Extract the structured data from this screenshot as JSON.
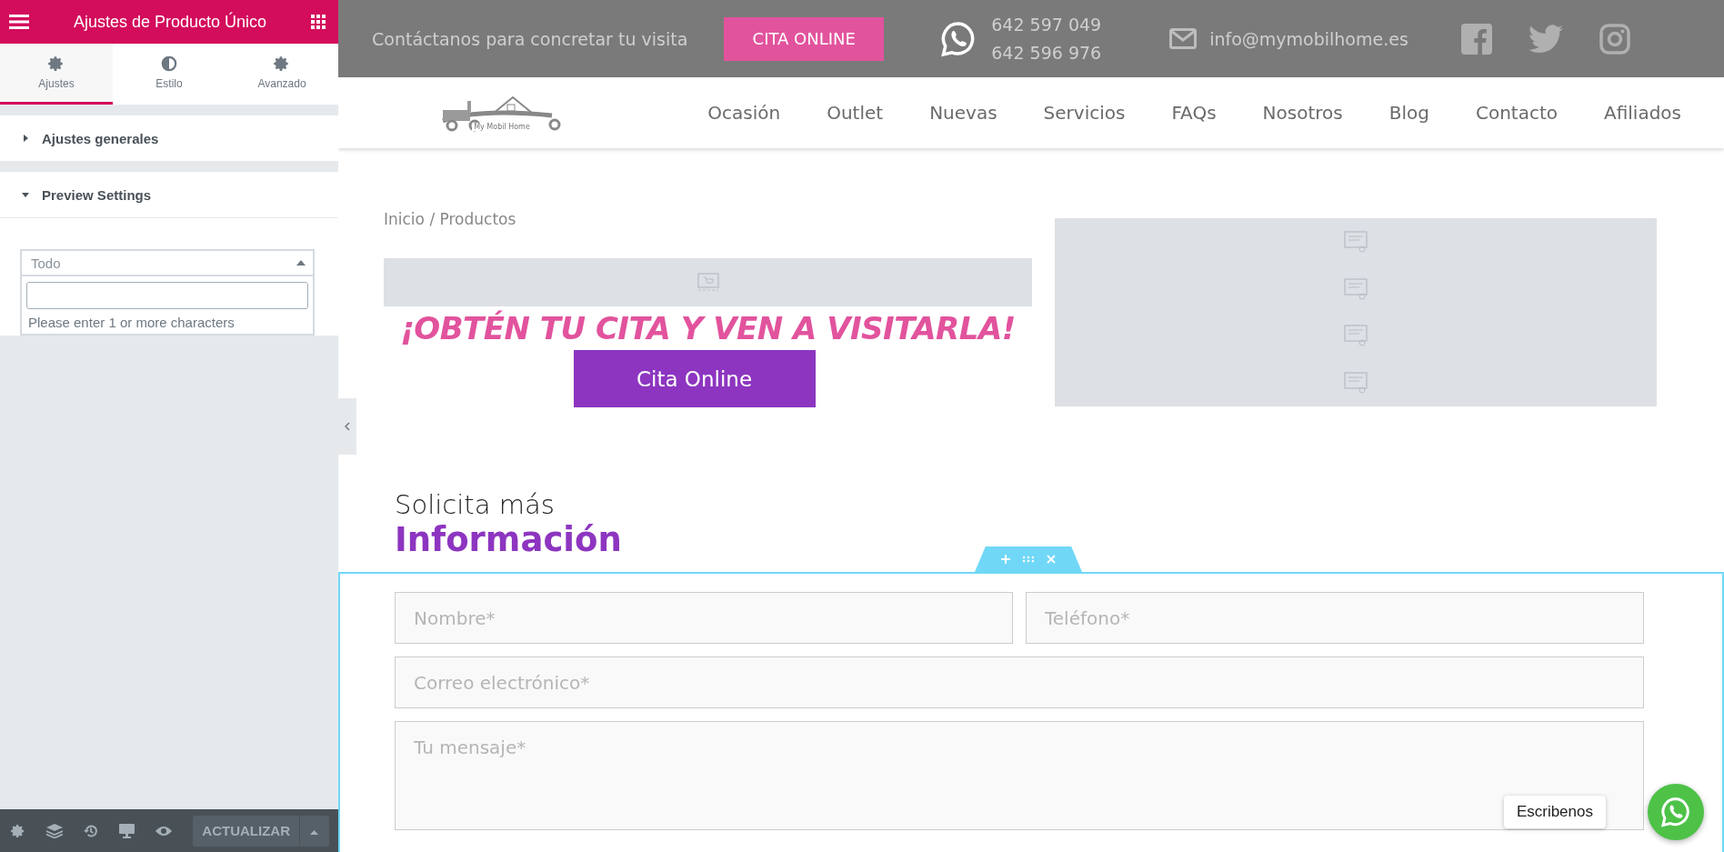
{
  "editor": {
    "title": "Ajustes de Producto Único",
    "tabs": [
      {
        "label": "Ajustes",
        "selected": true,
        "kind": "gear"
      },
      {
        "label": "Estilo",
        "selected": false,
        "kind": "contrast"
      },
      {
        "label": "Avanzado",
        "selected": false,
        "kind": "gear"
      }
    ],
    "sections": [
      {
        "label": "Ajustes generales",
        "expanded": false
      },
      {
        "label": "Preview Settings",
        "expanded": true
      }
    ],
    "select": {
      "value": "Todo",
      "open": true,
      "message": "Please enter 1 or more characters"
    },
    "footer": {
      "button": "ACTUALIZAR"
    }
  },
  "site": {
    "topbar": {
      "text": "Contáctanos para concretar tu visita",
      "button": "CITA ONLINE",
      "phones": [
        "642 597 049",
        "642 596 976"
      ],
      "email": "info@mymobilhome.es"
    },
    "logo": {
      "name": "My Mobil Home"
    },
    "nav": [
      "Ocasión",
      "Outlet",
      "Nuevas",
      "Servicios",
      "FAQs",
      "Nosotros",
      "Blog",
      "Contacto",
      "Afiliados"
    ],
    "breadcrumb": "Inicio / Productos",
    "headline": "¡OBTÉN TU CITA Y VEN A VISITARLA!",
    "cta": "Cita Online",
    "form_title": {
      "line_1": "Solicita más",
      "line_2": "Información"
    },
    "fields": [
      {
        "placeholder": "Nombre*",
        "kind": "half"
      },
      {
        "placeholder": "Teléfono*",
        "kind": "half"
      },
      {
        "placeholder": "Correo electrónico*",
        "kind": "full"
      },
      {
        "placeholder": "Tu mensaje*",
        "kind": "area"
      }
    ],
    "chat": {
      "label": "Escribenos"
    }
  }
}
